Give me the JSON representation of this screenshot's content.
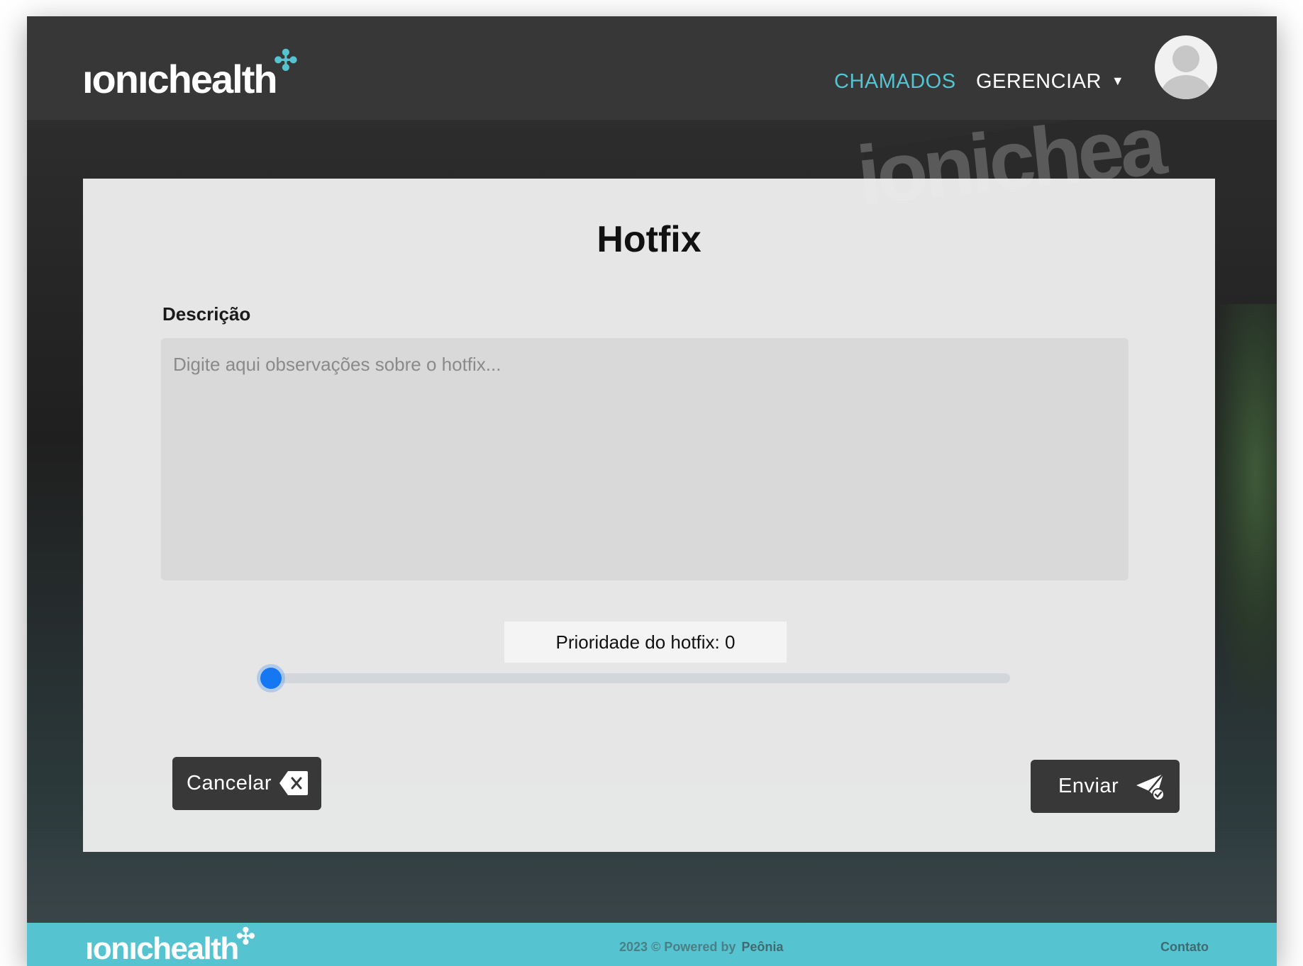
{
  "header": {
    "logo_text": "ıonıchealth",
    "nav": {
      "chamados": "CHAMADOS",
      "gerenciar": "GERENCIAR"
    },
    "accent_color": "#56c4d0"
  },
  "form": {
    "title": "Hotfix",
    "description_label": "Descrição",
    "description_placeholder": "Digite aqui observações sobre o hotfix...",
    "description_value": "",
    "priority_label": "Prioridade do hotfix: 0",
    "priority_value": 0,
    "cancel_label": "Cancelar",
    "send_label": "Enviar",
    "slider_color": "#1577f2"
  },
  "footer": {
    "logo_text": "ıonıchealth",
    "copyright": "2023 © Powered by",
    "brand": "Peônia",
    "contact": "Contato",
    "background_color": "#56c4d0"
  },
  "icons": {
    "cancel": "backspace-x-icon",
    "send": "paper-plane-check-icon",
    "caret": "caret-down-icon",
    "avatar": "user-avatar-icon"
  }
}
